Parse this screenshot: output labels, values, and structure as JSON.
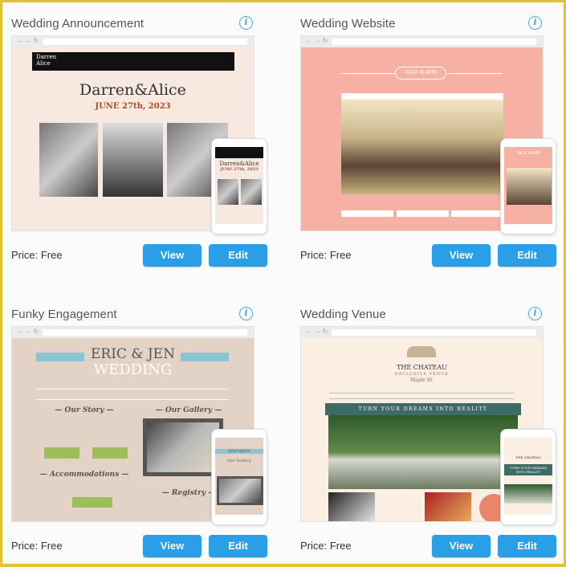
{
  "cards": [
    {
      "title": "Wedding Announcement",
      "price": "Price: Free",
      "view": "View",
      "edit": "Edit",
      "preview": {
        "logo": "Darren Alice",
        "names": "Darren&Alice",
        "date": "JUNE 27th, 2023"
      }
    },
    {
      "title": "Wedding Website",
      "price": "Price: Free",
      "view": "View",
      "edit": "Edit",
      "preview": {
        "names": "JACK & ANN"
      }
    },
    {
      "title": "Funky Engagement",
      "price": "Price: Free",
      "view": "View",
      "edit": "Edit",
      "preview": {
        "line1": "ERIC & JEN",
        "line2": "WEDDING",
        "story": "— Our Story —",
        "gallery": "— Our Gallery —",
        "accommodations": "— Accommodations —",
        "registry": "— Registry —",
        "mobile_names": "ERIC&JEN",
        "mobile_gallery": "Our Gallery"
      }
    },
    {
      "title": "Wedding Venue",
      "price": "Price: Free",
      "view": "View",
      "edit": "Edit",
      "preview": {
        "name": "THE CHATEAU",
        "sub": "EXCLUSIVE VENUE",
        "script": "Maple St.",
        "banner": "TURN YOUR DREAMS INTO REALITY",
        "mobile_banner": "TURN YOUR DREAMS INTO REALITY"
      }
    }
  ],
  "colors": {
    "accent": "#2b9ee8",
    "border": "#e2c231",
    "info": "#4aa8e0"
  }
}
